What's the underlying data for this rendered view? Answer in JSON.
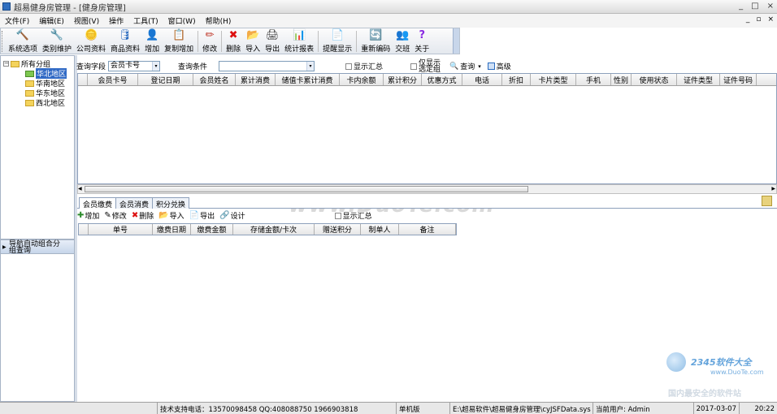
{
  "window": {
    "title": "超易健身房管理 - [健身房管理]",
    "controls": [
      "_",
      "□",
      "×"
    ]
  },
  "menu": {
    "items": [
      "文件(F)",
      "编辑(E)",
      "视图(V)",
      "操作",
      "工具(T)",
      "窗口(W)",
      "帮助(H)"
    ],
    "mdi_controls": [
      "_",
      "▫",
      "×"
    ]
  },
  "toolbar": {
    "buttons": [
      {
        "label": "系统选项",
        "icon": "hammer-icon",
        "glyph": "🔨"
      },
      {
        "label": "类别维护",
        "icon": "tools-icon",
        "glyph": "🔧"
      },
      {
        "label": "公司资料",
        "icon": "coins-icon",
        "glyph": "🪙"
      },
      {
        "label": "商品资料",
        "icon": "database-icon",
        "glyph": "🛢"
      },
      {
        "label": "增加",
        "icon": "add-user-icon",
        "glyph": "👤"
      },
      {
        "label": "复制增加",
        "icon": "copy-add-icon",
        "glyph": "📋"
      },
      {
        "label": "修改",
        "icon": "pencil-icon",
        "glyph": "✏"
      },
      {
        "label": "删除",
        "icon": "delete-icon",
        "glyph": "✖"
      },
      {
        "label": "导入",
        "icon": "import-icon",
        "glyph": "📂"
      },
      {
        "label": "导出",
        "icon": "printer-icon",
        "glyph": "🖨"
      },
      {
        "label": "统计报表",
        "icon": "chart-icon",
        "glyph": "📊"
      },
      {
        "label": "提醒显示",
        "icon": "reminder-icon",
        "glyph": "📄"
      },
      {
        "label": "重新编码",
        "icon": "recode-icon",
        "glyph": "🔄"
      },
      {
        "label": "交班",
        "icon": "shift-icon",
        "glyph": "👥"
      },
      {
        "label": "关于",
        "icon": "help-icon",
        "glyph": "?"
      }
    ]
  },
  "tree": {
    "root": "所有分组",
    "children": [
      "华北地区",
      "华南地区",
      "华东地区",
      "西北地区"
    ],
    "selected": "华北地区"
  },
  "nav_panel": {
    "title": "导航自动组合分组查询"
  },
  "query": {
    "field_label": "查询字段",
    "field_value": "会员卡号",
    "condition_label": "查询条件",
    "condition_value": "",
    "show_summary": "显示汇总",
    "show_only_selected": "仅显示选定组",
    "search_button": "查询",
    "advanced_button": "高级"
  },
  "main_grid": {
    "columns": [
      "会员卡号",
      "登记日期",
      "会员姓名",
      "累计消费",
      "储值卡累计消费",
      "卡内余额",
      "累计积分",
      "优惠方式",
      "电话",
      "折扣",
      "卡片类型",
      "手机",
      "性别",
      "使用状态",
      "证件类型",
      "证件号码"
    ],
    "rows": []
  },
  "detail_tabs": {
    "items": [
      "会员缴费",
      "会员消费",
      "积分兑换"
    ],
    "active": 0
  },
  "detail_toolbar": {
    "buttons": [
      {
        "label": "增加",
        "icon": "add-icon",
        "glyph": "✚"
      },
      {
        "label": "修改",
        "icon": "edit-icon",
        "glyph": "✎"
      },
      {
        "label": "删除",
        "icon": "delete-icon",
        "glyph": "✖"
      },
      {
        "label": "导入",
        "icon": "import-icon",
        "glyph": "📂"
      },
      {
        "label": "导出",
        "icon": "export-icon",
        "glyph": "📄"
      },
      {
        "label": "设计",
        "icon": "design-icon",
        "glyph": "🔗"
      }
    ],
    "show_summary": "显示汇总"
  },
  "detail_grid": {
    "columns": [
      "单号",
      "缴费日期",
      "缴费金额",
      "存储金额/卡次",
      "赠送积分",
      "制单人",
      "备注"
    ],
    "rows": []
  },
  "watermark": {
    "text": "www.DuoTe.com",
    "site_logo": "2345软件大全",
    "site_url": "www.DuoTe.com",
    "site_tag": "国内最安全的软件站"
  },
  "status": {
    "support": "技术支持电话：13570098458 QQ:408088750 1966903818",
    "mode": "单机版",
    "path": "E:\\超易软件\\超易健身房管理\\cyJSFData.sys",
    "user": "当前用户: Admin",
    "date": "2017-03-07",
    "time": "20:22"
  },
  "colors": {
    "accent": "#316ac5",
    "border": "#8da0bb"
  }
}
